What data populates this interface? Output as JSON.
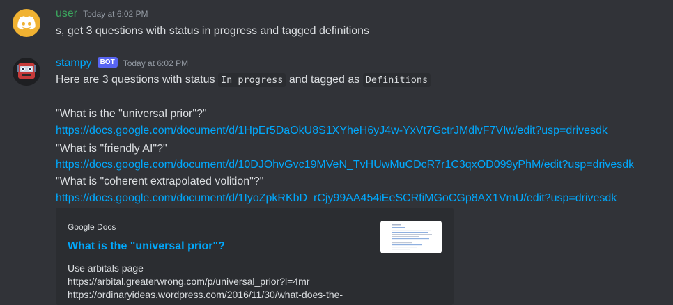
{
  "messages": {
    "user": {
      "username": "user",
      "timestamp": "Today at 6:02 PM",
      "text": "s, get 3 questions with status in progress and tagged definitions"
    },
    "bot": {
      "username": "stampy",
      "badge": "BOT",
      "timestamp": "Today at 6:02 PM",
      "intro_prefix": "Here are 3 questions with status ",
      "status_code": "In progress",
      "intro_middle": " and tagged as ",
      "tag_code": "Definitions",
      "questions": [
        {
          "title": "\"What is the \"universal prior\"?\"",
          "url": "https://docs.google.com/document/d/1HpEr5DaOkU8S1XYheH6yJ4w-YxVt7GctrJMdlvF7VIw/edit?usp=drivesdk"
        },
        {
          "title": "\"What is \"friendly AI\"?\"",
          "url": "https://docs.google.com/document/d/10DJOhvGvc19MVeN_TvHUwMuCDcR7r1C3qxOD099yPhM/edit?usp=drivesdk"
        },
        {
          "title": "\"What is \"coherent extrapolated volition\"?\"",
          "url": "https://docs.google.com/document/d/1IyoZpkRKbD_rCjy99AA454iEeSCRfiMGoCGp8AX1VmU/edit?usp=drivesdk"
        }
      ],
      "embed": {
        "provider": "Google Docs",
        "title": "What is the \"universal prior\"?",
        "description_lines": [
          "Use arbitals page",
          "https://arbital.greaterwrong.com/p/universal_prior?l=4mr",
          "https://ordinaryideas.wordpress.com/2016/11/30/what-does-the-"
        ]
      }
    }
  },
  "colors": {
    "background": "#313338",
    "link": "#00a8fc",
    "user_name": "#3ba55d",
    "bot_badge": "#5865f2"
  }
}
